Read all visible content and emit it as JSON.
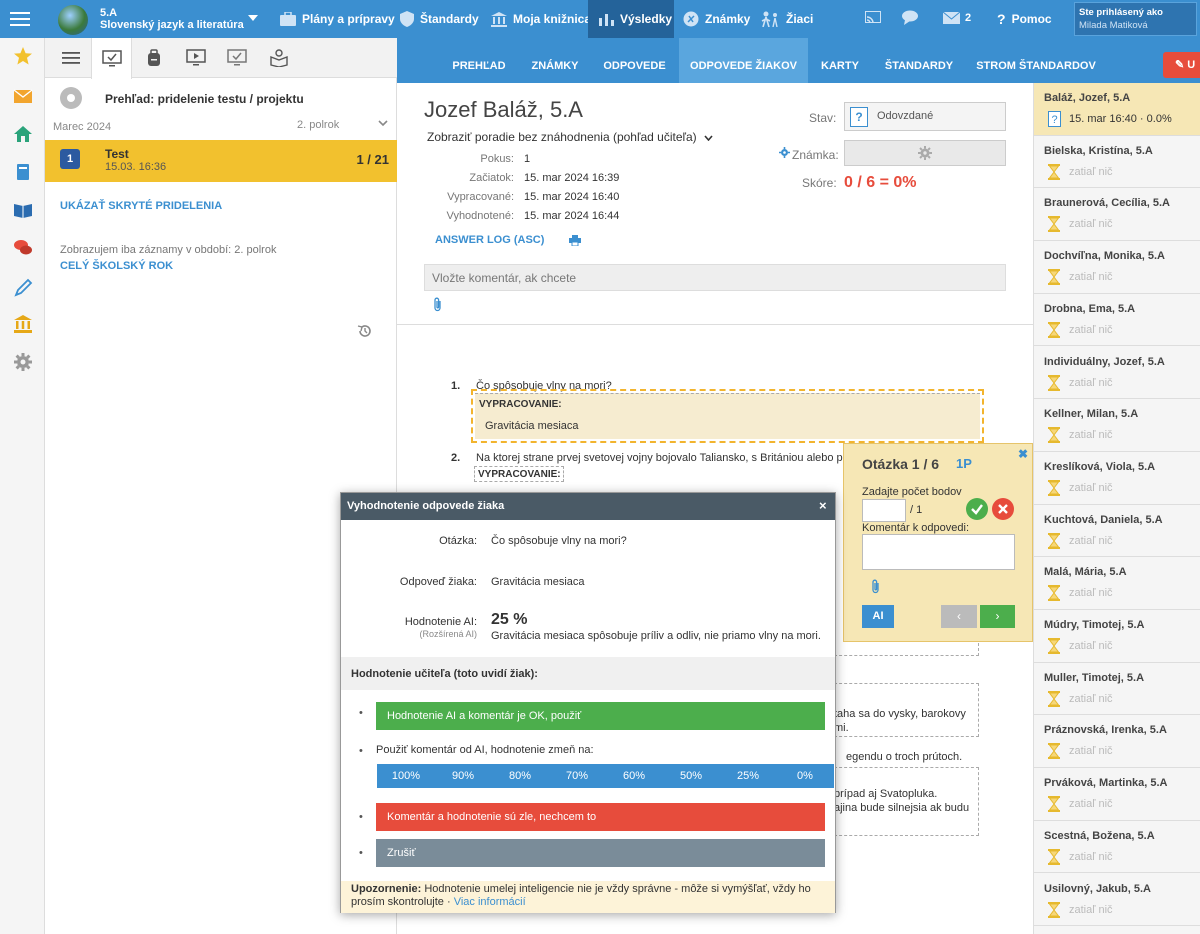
{
  "topbar": {
    "class": "5.A",
    "subject": "Slovenský jazyk a literatúra",
    "nav": [
      {
        "label": "Plány a prípravy",
        "icon": "briefcase-icon"
      },
      {
        "label": "Štandardy",
        "icon": "shield-icon"
      },
      {
        "label": "Moja knižnica",
        "icon": "library-icon"
      },
      {
        "label": "Výsledky",
        "icon": "bar-chart-icon"
      },
      {
        "label": "Známky",
        "icon": "marks-icon"
      },
      {
        "label": "Žiaci",
        "icon": "students-icon"
      }
    ],
    "messages_count": "2",
    "help": "Pomoc",
    "login_label": "Ste prihlásený ako",
    "login_user": "Milada Matiková"
  },
  "left_panel": {
    "overview_title": "Prehľad: pridelenie testu / projektu",
    "month": "Marec 2024",
    "half": "2. polrok",
    "test": {
      "num": "1",
      "name": "Test",
      "date": "15.03. 16:36",
      "count": "1 / 21"
    },
    "show_hidden": "UKÁZAŤ SKRYTÉ PRIDELENIA",
    "note": "Zobrazujem iba záznamy v období: 2. polrok",
    "whole_year": "CELÝ ŠKOLSKÝ ROK"
  },
  "subnav": {
    "tabs": [
      "PREHĽAD",
      "ZNÁMKY",
      "ODPOVEDE",
      "ODPOVEDE ŽIAKOV",
      "KARTY",
      "ŠTANDARDY",
      "STROM ŠTANDARDOV"
    ],
    "red_btn": "U"
  },
  "student": {
    "name": "Jozef Baláž, 5.A",
    "order": "Zobraziť poradie bez znáhodnenia (pohľad učiteľa)",
    "meta": [
      {
        "label": "Pokus:",
        "value": "1"
      },
      {
        "label": "Začiatok:",
        "value": "15. mar 2024 16:39"
      },
      {
        "label": "Vypracované:",
        "value": "15. mar 2024 16:40"
      },
      {
        "label": "Vyhodnotené:",
        "value": "15. mar 2024 16:44"
      }
    ],
    "answer_log": "ANSWER LOG (ASC)",
    "stav_label": "Stav:",
    "stav_value": "Odovzdané",
    "znamka_label": "Známka:",
    "skore_label": "Skóre:",
    "skore_value": "0 / 6 = 0%",
    "comment_placeholder": "Vložte komentár, ak chcete"
  },
  "questions": {
    "q1_num": "1.",
    "q1_text": "Čo spôsobuje vlny na mori?",
    "vyp_label": "VYPRACOVANIE:",
    "q1_answer": "Gravitácia mesiaca",
    "q2_num": "2.",
    "q2_text": "Na ktorej strane prvej svetovej vojny bojovalo Taliansko, s Britániou alebo pro",
    "frag1": "taha sa do vysky, barokovy",
    "frag2": "mi.",
    "frag3": "egendu o troch prútoch.",
    "frag4": "prípad aj Svatopluka.",
    "frag5": "ajina bude silnejsia ak budu"
  },
  "qpopup": {
    "title": "Otázka 1 / 6",
    "points": "1P",
    "enter_points": "Zadajte počet bodov",
    "out_of": "/ 1",
    "comment_label": "Komentár k odpovedi:",
    "ai": "AI",
    "prev": "‹",
    "next": "›"
  },
  "students": [
    {
      "name": "Baláž, Jozef, 5.A",
      "status": "15. mar 16:40 · 0.0%"
    },
    {
      "name": "Bielska, Kristína, 5.A",
      "status": "zatiaľ nič"
    },
    {
      "name": "Braunerová, Cecília, 5.A",
      "status": "zatiaľ nič"
    },
    {
      "name": "Dochvíľna, Monika, 5.A",
      "status": "zatiaľ nič"
    },
    {
      "name": "Drobna, Ema, 5.A",
      "status": "zatiaľ nič"
    },
    {
      "name": "Individuálny, Jozef, 5.A",
      "status": "zatiaľ nič"
    },
    {
      "name": "Kellner, Milan, 5.A",
      "status": "zatiaľ nič"
    },
    {
      "name": "Kreslíková, Viola, 5.A",
      "status": "zatiaľ nič"
    },
    {
      "name": "Kuchtová, Daniela, 5.A",
      "status": "zatiaľ nič"
    },
    {
      "name": "Malá, Mária, 5.A",
      "status": "zatiaľ nič"
    },
    {
      "name": "Múdry, Timotej, 5.A",
      "status": "zatiaľ nič"
    },
    {
      "name": "Muller, Timotej, 5.A",
      "status": "zatiaľ nič"
    },
    {
      "name": "Práznovská, Irenka, 5.A",
      "status": "zatiaľ nič"
    },
    {
      "name": "Prváková, Martinka, 5.A",
      "status": "zatiaľ nič"
    },
    {
      "name": "Scestná, Božena, 5.A",
      "status": "zatiaľ nič"
    },
    {
      "name": "Usilovný, Jakub, 5.A",
      "status": "zatiaľ nič"
    }
  ],
  "modal": {
    "title": "Vyhodnotenie odpovede žiaka",
    "close": "×",
    "q_label": "Otázka:",
    "q_value": "Čo spôsobuje vlny na mori?",
    "a_label": "Odpoveď žiaka:",
    "a_value": "Gravitácia mesiaca",
    "ai_label": "Hodnotenie AI:",
    "ai_sub": "(Rozšírená AI)",
    "ai_score": "25 %",
    "ai_comment": "Gravitácia mesiaca spôsobuje príliv a odliv, nie priamo vlny na mori.",
    "teacher_title": "Hodnotenie učiteľa (toto uvidí žiak):",
    "ok_btn": "Hodnotenie AI a komentár je OK, použiť",
    "change_label": "Použiť komentár od AI, hodnotenie zmeň na:",
    "percents": [
      "100%",
      "90%",
      "80%",
      "70%",
      "60%",
      "50%",
      "25%",
      "0%"
    ],
    "bad_btn": "Komentár a hodnotenie sú zle, nechcem to",
    "cancel_btn": "Zrušiť",
    "warn_bold": "Upozornenie:",
    "warn_text": " Hodnotenie umelej inteligencie nie je vždy správne - môže si vymýšľať, vždy ho prosím skontrolujte · ",
    "warn_link": "Viac informácií"
  },
  "colors": {
    "primary": "#3b8fd0",
    "dark": "#24639a",
    "yellow": "#f2c12e",
    "green": "#4cae4c",
    "red": "#e74c3c",
    "gray": "#7a8c99"
  }
}
